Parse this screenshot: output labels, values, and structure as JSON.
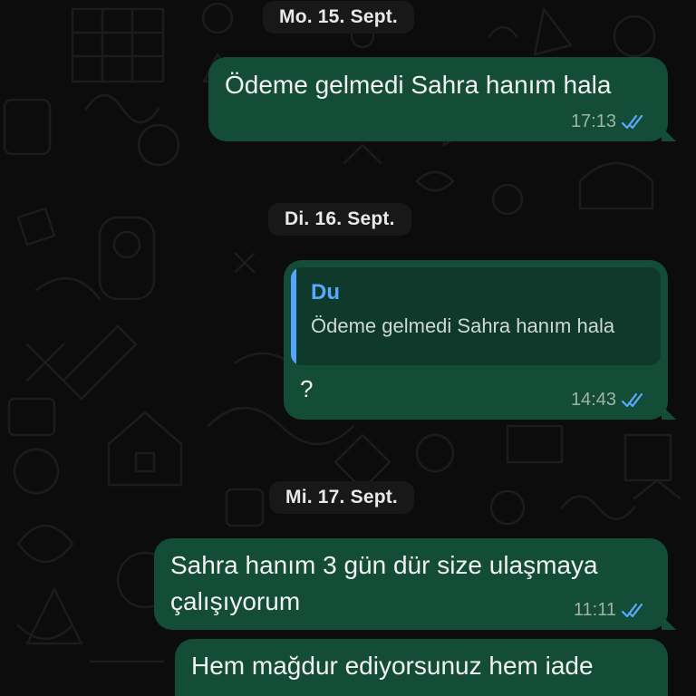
{
  "colors": {
    "background": "#0c0c0c",
    "outgoing_bubble": "#134d37",
    "quote_bar": "#53a6ff",
    "read_ticks": "#5aa9ff"
  },
  "dates": [
    "Mo. 15. Sept.",
    "Di. 16. Sept.",
    "Mi. 17. Sept."
  ],
  "messages": [
    {
      "text": "Ödeme gelmedi Sahra hanım hala",
      "time": "17:13",
      "status_icon": "double-check-read"
    },
    {
      "reply_to": {
        "author": "Du",
        "text": "Ödeme gelmedi Sahra hanım hala"
      },
      "text": "?",
      "time": "14:43",
      "status_icon": "double-check-read"
    },
    {
      "text_lines": [
        "Sahra hanım 3 gün dür size ulaşmaya",
        "çalışıyorum"
      ],
      "time": "11:11",
      "status_icon": "double-check-read"
    },
    {
      "text": "Hem mağdur ediyorsunuz hem iade"
    }
  ]
}
